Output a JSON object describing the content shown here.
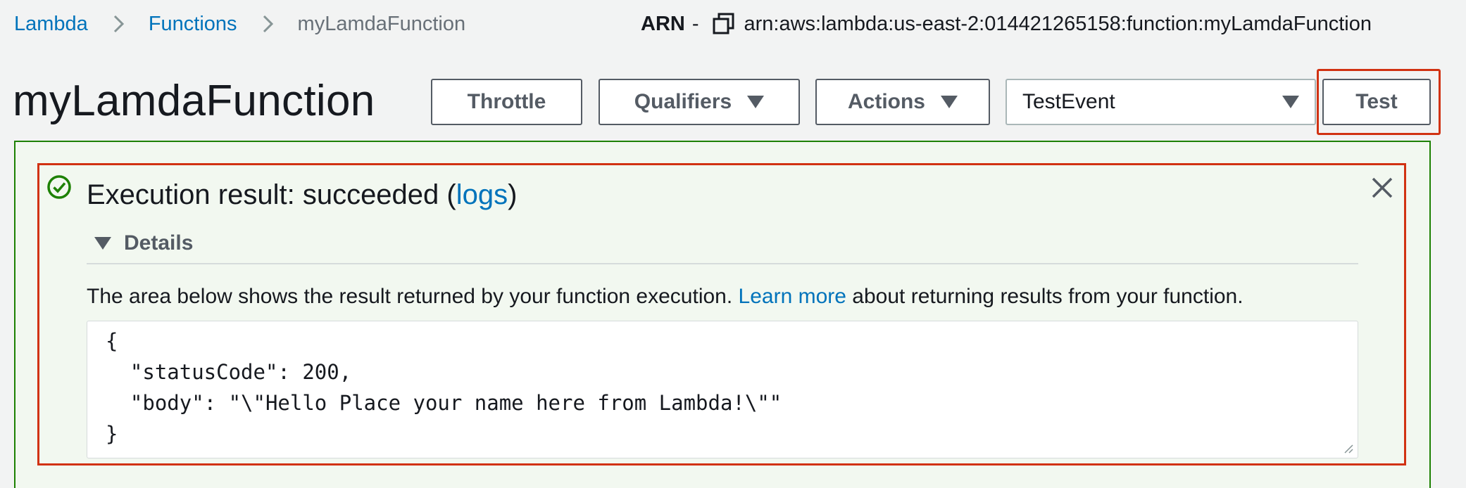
{
  "breadcrumb": {
    "items": [
      {
        "label": "Lambda"
      },
      {
        "label": "Functions"
      },
      {
        "label": "myLamdaFunction"
      }
    ]
  },
  "arn": {
    "label": "ARN",
    "dash": "-",
    "copy_icon": "copy-icon",
    "value": "arn:aws:lambda:us-east-2:014421265158:function:myLamdaFunction"
  },
  "function": {
    "title": "myLamdaFunction"
  },
  "toolbar": {
    "throttle_label": "Throttle",
    "qualifiers_label": "Qualifiers",
    "actions_label": "Actions",
    "test_event_selected": "TestEvent",
    "test_label": "Test"
  },
  "result": {
    "status_icon": "check-circle-icon",
    "title_prefix": "Execution result: succeeded (",
    "logs_link": "logs",
    "title_suffix": ")",
    "details_label": "Details",
    "description_prefix": "The area below shows the result returned by your function execution.",
    "learn_more_link": "Learn more",
    "description_suffix": "about returning results from your function.",
    "output": "{\n  \"statusCode\": 200,\n  \"body\": \"\\\"Hello Place your name here from Lambda!\\\"\"\n}"
  },
  "colors": {
    "link": "#0073bb",
    "success": "#1d8102",
    "success_bg": "#f2f8f0",
    "highlight": "#d13212",
    "page_bg": "#f2f3f3"
  }
}
